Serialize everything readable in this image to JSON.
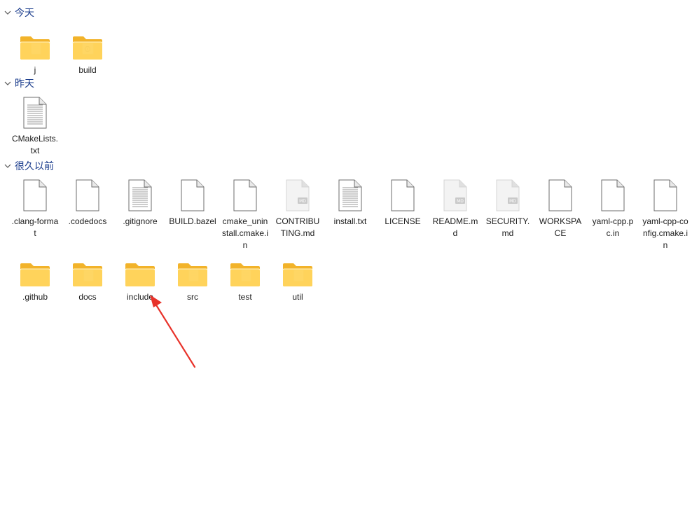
{
  "groups": [
    {
      "label": "今天",
      "items": [
        {
          "name": "j",
          "kind": "folder-doc"
        },
        {
          "name": "build",
          "kind": "folder-gear"
        }
      ]
    },
    {
      "label": "昨天",
      "items": [
        {
          "name": "CMakeLists.txt",
          "kind": "text-file"
        }
      ]
    },
    {
      "label": "很久以前",
      "items": [
        {
          "name": ".clang-format",
          "kind": "blank-file"
        },
        {
          "name": ".codedocs",
          "kind": "blank-file"
        },
        {
          "name": ".gitignore",
          "kind": "text-file"
        },
        {
          "name": "BUILD.bazel",
          "kind": "blank-file"
        },
        {
          "name": "cmake_uninstall.cmake.in",
          "kind": "blank-file"
        },
        {
          "name": "CONTRIBUTING.md",
          "kind": "md-file"
        },
        {
          "name": "install.txt",
          "kind": "text-file"
        },
        {
          "name": "LICENSE",
          "kind": "blank-file"
        },
        {
          "name": "README.md",
          "kind": "md-file"
        },
        {
          "name": "SECURITY.md",
          "kind": "md-file"
        },
        {
          "name": "WORKSPACE",
          "kind": "blank-file"
        },
        {
          "name": "yaml-cpp.pc.in",
          "kind": "blank-file"
        },
        {
          "name": "yaml-cpp-config.cmake.in",
          "kind": "blank-file"
        },
        {
          "name": ".github",
          "kind": "folder"
        },
        {
          "name": "docs",
          "kind": "folder-doc"
        },
        {
          "name": "include",
          "kind": "folder"
        },
        {
          "name": "src",
          "kind": "folder-doc"
        },
        {
          "name": "test",
          "kind": "folder-doc"
        },
        {
          "name": "util",
          "kind": "folder-doc"
        }
      ]
    }
  ],
  "annotation": {
    "type": "red-arrow",
    "target": "include",
    "color": "#e8322a"
  },
  "colors": {
    "group_header": "#1a3c8c",
    "folder_back": "#f2b32a",
    "folder_front": "#ffd45e",
    "md_badge": "#7a7a7a"
  }
}
